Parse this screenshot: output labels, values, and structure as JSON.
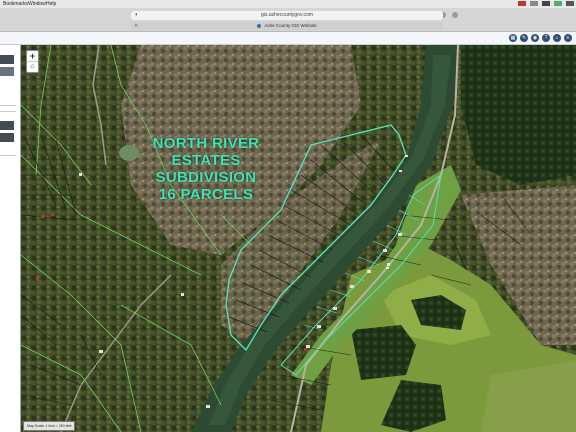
{
  "menubar": {
    "items": [
      "Bookmarks",
      "Window",
      "Help"
    ]
  },
  "browser": {
    "url": "gis.ashecountygov.com",
    "tab_title": "Ashe County GIS Website"
  },
  "map": {
    "label_lines": [
      "NORTH RIVER",
      "ESTATES",
      "SUBDIVISION",
      "16 PARCELS"
    ],
    "scale_text": "Map Scale: 1 inch = 250 feet",
    "label_color": "#3fe2b2",
    "boundary_color": "#58e0b5",
    "parcel_line_color": "#6dd15a"
  }
}
